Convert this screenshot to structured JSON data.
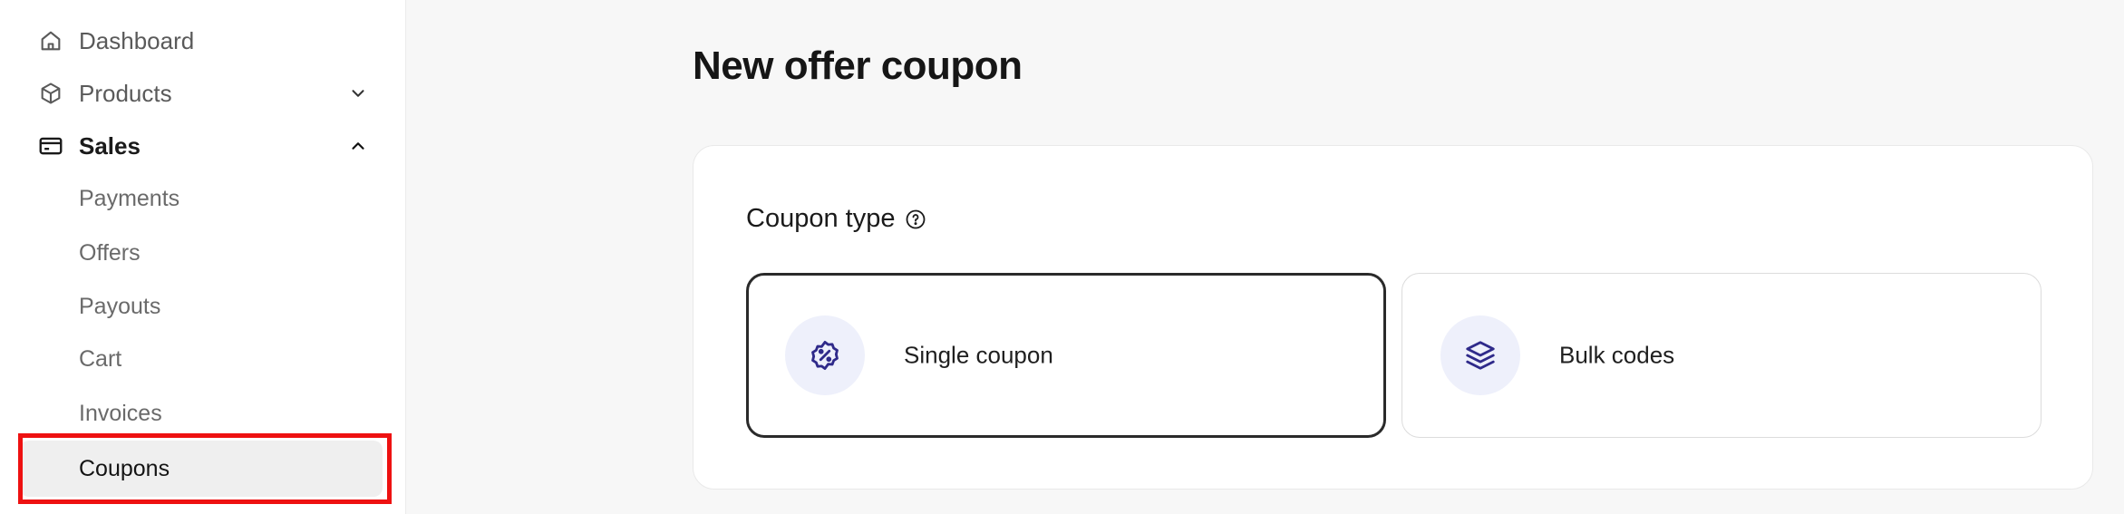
{
  "sidebar": {
    "items": [
      {
        "label": "Dashboard",
        "icon": "home-icon"
      },
      {
        "label": "Products",
        "icon": "box-icon",
        "expanded": false
      },
      {
        "label": "Sales",
        "icon": "credit-card-icon",
        "expanded": true,
        "active": true
      }
    ],
    "sales_subitems": [
      {
        "label": "Payments"
      },
      {
        "label": "Offers"
      },
      {
        "label": "Payouts"
      },
      {
        "label": "Cart"
      },
      {
        "label": "Invoices"
      },
      {
        "label": "Coupons",
        "selected": true
      }
    ]
  },
  "main": {
    "title": "New offer coupon",
    "coupon_type": {
      "heading": "Coupon type",
      "options": [
        {
          "label": "Single coupon",
          "icon": "discount-badge-icon",
          "selected": true
        },
        {
          "label": "Bulk codes",
          "icon": "layers-icon",
          "selected": false
        }
      ]
    }
  },
  "colors": {
    "highlight": "#ee1111",
    "icon_accent": "#2f2a8a",
    "icon_bg": "#eef0fb"
  }
}
